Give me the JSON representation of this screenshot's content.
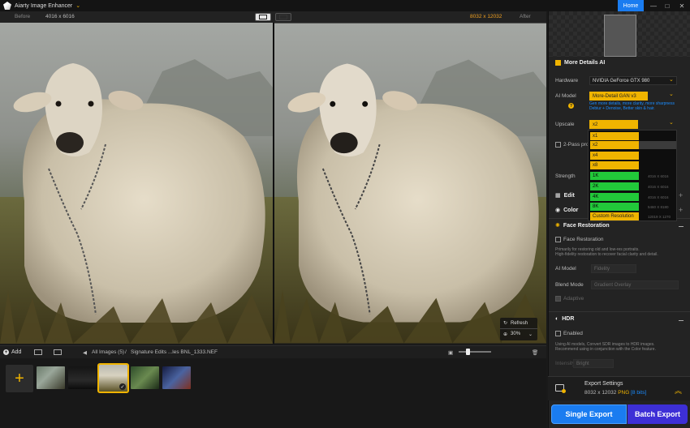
{
  "titlebar": {
    "app_title": "Aiarty Image Enhancer",
    "home_label": "Home",
    "minimize": "—",
    "maximize": "□",
    "close": "✕"
  },
  "compare": {
    "before_label": "Before",
    "before_res": "4016 x 6016",
    "after_res": "8032 x 12032",
    "after_label": "After"
  },
  "preview_controls": {
    "refresh_label": "Refresh",
    "zoom_value": "30%"
  },
  "bottom_bar": {
    "add_label": "Add",
    "breadcrumb_all": "All Images (5)",
    "breadcrumb_sep": "/",
    "breadcrumb_file": "Signature Edits ...les BNL_1333.NEF"
  },
  "panel": {
    "more_details_title": "More Details AI",
    "hardware_label": "Hardware",
    "hardware_value": "NVIDIA GeForce GTX 980",
    "ai_model_label": "AI Model",
    "ai_model_value": "More-Detail GAN v3",
    "ai_model_desc_1": "Gen more details, more clarity, more sharpness",
    "ai_model_desc_2": "Debiur + Denoise, Better skin & hair.",
    "upscale_label": "Upscale",
    "upscale_value": "x2",
    "two_pass_label": "2-Pass proc",
    "strength_label": "Strength",
    "edit_label": "Edit",
    "color_label": "Color",
    "face_title": "Face Restoration",
    "face_checkbox_label": "Face Restoration",
    "face_desc_1": "Primarily for restoring old and low-res portraits.",
    "face_desc_2": "High-fidelity restoration to recover facial clarity and detail.",
    "face_model_label": "AI Model",
    "face_model_value": "Fidelity",
    "blend_label": "Blend Mode",
    "blend_value": "Gradient Overlay",
    "adaptive_label": "Adaptive",
    "hdr_title": "HDR",
    "hdr_enabled_label": "Enabled",
    "hdr_desc_1": "Using AI models, Convert SDR images to HDR images.",
    "hdr_desc_2": "Recommend using in conjunction with the Color feature.",
    "hdr_intensity_label": "Intensity",
    "hdr_intensity_value": "Bright"
  },
  "upscale_dropdown": {
    "options": [
      {
        "label": "x1",
        "res": ""
      },
      {
        "label": "x2",
        "res": ""
      },
      {
        "label": "x4",
        "res": ""
      },
      {
        "label": "x8",
        "res": ""
      },
      {
        "label": "1K",
        "res": "4016 X 6016"
      },
      {
        "label": "2K",
        "res": "4016 X 6016"
      },
      {
        "label": "4K",
        "res": "4016 X 6016"
      },
      {
        "label": "8K",
        "res": "5460 X 8180"
      },
      {
        "label": "Custom Resolution",
        "res": "12019 X 1270"
      }
    ]
  },
  "export": {
    "title": "Export Settings",
    "dimensions": "8032 x 12032",
    "format": "PNG",
    "bits": "[8 bits]",
    "single_label": "Single Export",
    "batch_label": "Batch Export"
  },
  "colors": {
    "accent_yellow": "#f0b400",
    "accent_blue": "#1a7cf0",
    "accent_purple": "#3d2fd6",
    "resolution_green": "#22c93a"
  }
}
